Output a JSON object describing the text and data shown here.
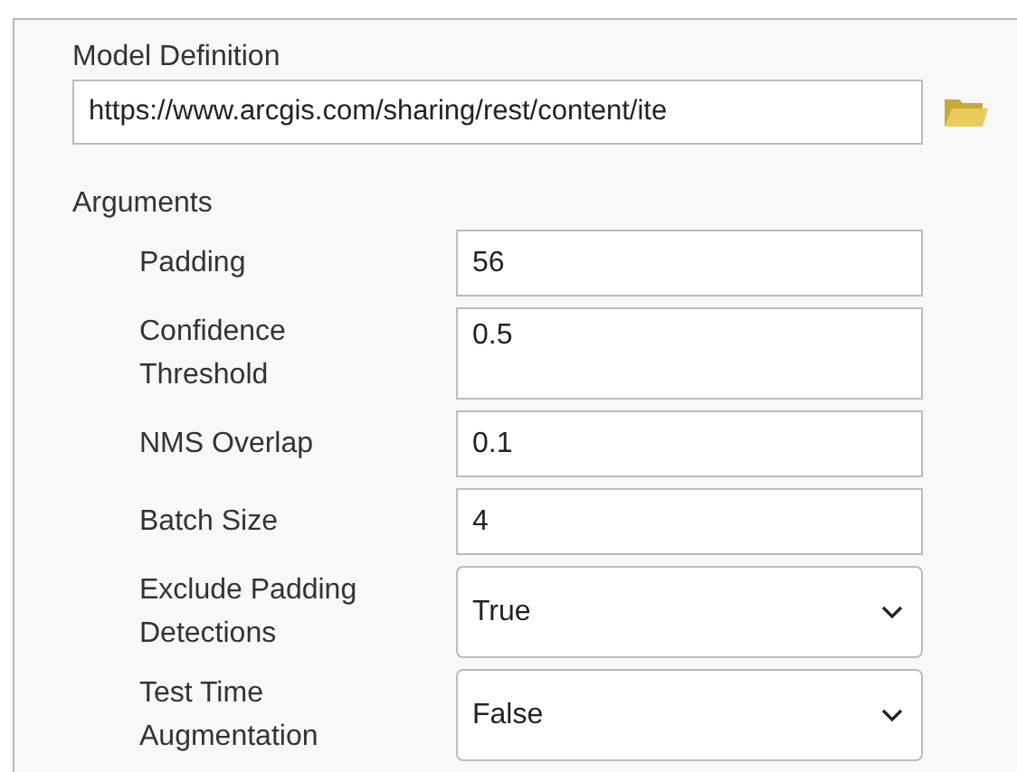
{
  "model_definition": {
    "label": "Model Definition",
    "value": "https://www.arcgis.com/sharing/rest/content/ite"
  },
  "arguments": {
    "heading": "Arguments",
    "items": [
      {
        "label": "Padding",
        "kind": "text",
        "value": "56"
      },
      {
        "label": "Confidence Threshold",
        "kind": "multiline",
        "value": "0.5"
      },
      {
        "label": "NMS Overlap",
        "kind": "text",
        "value": "0.1"
      },
      {
        "label": "Batch Size",
        "kind": "text",
        "value": "4"
      },
      {
        "label": "Exclude Padding Detections",
        "kind": "dropdown",
        "value": "True"
      },
      {
        "label": "Test Time Augmentation",
        "kind": "dropdown",
        "value": "False"
      }
    ]
  }
}
